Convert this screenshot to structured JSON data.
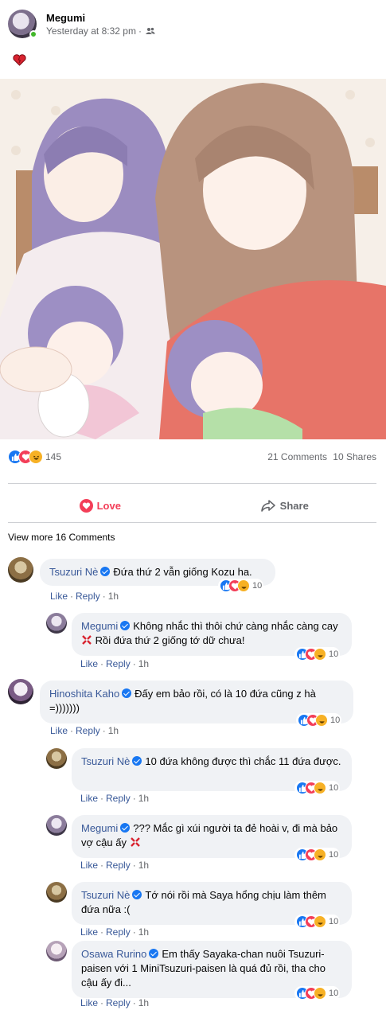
{
  "post": {
    "author": "Megumi",
    "time": "Yesterday at 8:32 pm",
    "separator": "·",
    "audience_icon": "friends-icon",
    "text_icon": "heart-emoji"
  },
  "image": {
    "description_icon": "anime-illustration"
  },
  "reactions": {
    "types": [
      "like",
      "love",
      "haha"
    ],
    "count": "145",
    "comments": "21 Comments",
    "shares": "10 Shares"
  },
  "actions": {
    "love_label": "Love",
    "share_label": "Share"
  },
  "view_more": "View more 16 Comments",
  "comment_action_labels": {
    "like": "Like",
    "reply": "Reply",
    "dot": "·"
  },
  "colors": {
    "like": "#1877f2",
    "love": "#f33e58",
    "haha": "#f7b125",
    "name": "#385898",
    "bubble": "#f0f2f5"
  },
  "comments": [
    {
      "name": "Tsuzuri Nè",
      "text": "Đứa thứ 2 vẫn giống Kozu ha.",
      "time": "1h",
      "react_count": "10"
    },
    {
      "name": "Megumi",
      "text_before": "Không nhắc thì thôi chứ càng nhắc càng cay",
      "text_after": "Rồi đứa thứ 2 giống tớ dữ chưa!",
      "time": "1h",
      "react_count": "10"
    },
    {
      "name": "Hinoshita Kaho",
      "text": "Đấy em bảo rồi, có là 10 đứa cũng z hà =)))))))",
      "time": "1h",
      "react_count": "10"
    },
    {
      "name": "Tsuzuri Nè",
      "text": "10 đứa không được thì chắc 11 đứa được.",
      "time": "1h",
      "react_count": "10"
    },
    {
      "name": "Megumi",
      "text": "??? Mắc gì xúi người ta đẻ hoài v, đi mà bảo vợ cậu ấy",
      "time": "1h",
      "react_count": "10"
    },
    {
      "name": "Tsuzuri Nè",
      "text": "Tớ nói rồi mà Saya hổng chịu làm thêm đứa nữa :(",
      "time": "1h",
      "react_count": "10"
    },
    {
      "name": "Osawa Rurino",
      "text": "Em thấy Sayaka-chan nuôi Tsuzuri-paisen với 1 MiniTsuzuri-paisen là quá đủ rồi, tha cho cậu ấy đi...",
      "time": "1h",
      "react_count": "10"
    }
  ]
}
